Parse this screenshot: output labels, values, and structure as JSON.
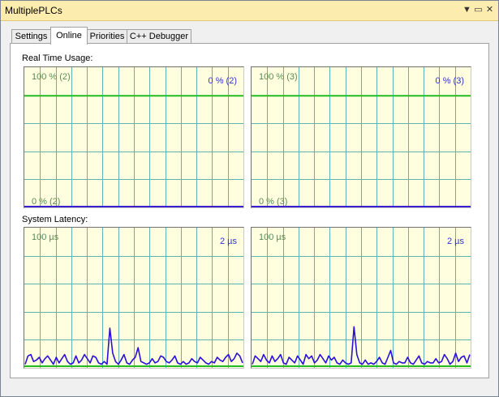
{
  "window": {
    "title": "MultiplePLCs"
  },
  "titlebar_icons": [
    "dropdown-arrow-icon",
    "maximize-icon",
    "close-icon"
  ],
  "titlebar_glyphs": {
    "dropdown": "▼",
    "maximize": "▭",
    "close": "✕"
  },
  "tabs": [
    {
      "label": "Settings",
      "active": false
    },
    {
      "label": "Online",
      "active": true
    },
    {
      "label": "Priorities",
      "active": false
    },
    {
      "label": "C++ Debugger",
      "active": false
    }
  ],
  "real_time_usage": {
    "label": "Real Time Usage:",
    "charts": [
      {
        "max_label": "100 % (2)",
        "current_label": "0 % (2)",
        "min_label": "0 % (2)",
        "limit_percent": 80,
        "usage_percent": 0
      },
      {
        "max_label": "100 % (3)",
        "current_label": "0 % (3)",
        "min_label": "0 % (3)",
        "limit_percent": 80,
        "usage_percent": 0
      }
    ]
  },
  "system_latency": {
    "label": "System Latency:",
    "charts": [
      {
        "max_label": "100 µs",
        "current_label": "2 µs"
      },
      {
        "max_label": "100 µs",
        "current_label": "2 µs"
      }
    ]
  },
  "colors": {
    "chart_background": "#ffffe0",
    "grid": "#5fb3b3",
    "limit_line": "#22bb22",
    "usage_line": "#3a1fd0",
    "latency_trace": "#2a10d8"
  },
  "chart_data": [
    {
      "type": "line",
      "title": "Real Time Usage (2)",
      "ylim": [
        0,
        100
      ],
      "ylabel": "%",
      "series": [
        {
          "name": "",
          "values": [
            0,
            0,
            0,
            0,
            0,
            0,
            0,
            0,
            0,
            0,
            0,
            0,
            0,
            0,
            0,
            0,
            0,
            0,
            0,
            0
          ]
        }
      ]
    },
    {
      "type": "line",
      "title": "Real Time Usage (3)",
      "ylim": [
        0,
        100
      ],
      "ylabel": "%",
      "series": [
        {
          "name": "",
          "values": [
            0,
            0,
            0,
            0,
            0,
            0,
            0,
            0,
            0,
            0,
            0,
            0,
            0,
            0,
            0,
            0,
            0,
            0,
            0,
            0
          ]
        }
      ]
    },
    {
      "type": "line",
      "title": "System Latency",
      "ylim": [
        0,
        100
      ],
      "ylabel": "µs",
      "series": [
        {
          "name": "",
          "values": [
            2,
            8,
            9,
            4,
            5,
            7,
            3,
            6,
            8,
            5,
            2,
            7,
            3,
            6,
            9,
            4,
            2,
            3,
            8,
            3,
            5,
            9,
            6,
            3,
            8,
            7,
            3,
            2,
            4,
            2,
            28,
            10,
            4,
            2,
            5,
            9,
            3,
            2,
            5,
            7,
            14,
            4,
            3,
            2,
            3,
            6,
            3,
            4,
            8,
            7,
            4,
            3,
            5,
            8,
            3,
            2,
            4,
            2,
            3,
            6,
            4,
            3,
            7,
            5,
            3,
            2,
            4,
            3,
            7,
            5,
            4,
            7,
            9,
            4,
            6,
            10,
            8,
            3
          ]
        }
      ]
    },
    {
      "type": "line",
      "title": "System Latency",
      "ylim": [
        0,
        100
      ],
      "ylabel": "µs",
      "series": [
        {
          "name": "",
          "values": [
            2,
            8,
            6,
            4,
            9,
            5,
            3,
            8,
            4,
            6,
            9,
            3,
            2,
            7,
            5,
            3,
            8,
            5,
            2,
            9,
            6,
            8,
            3,
            5,
            9,
            6,
            3,
            8,
            5,
            7,
            3,
            2,
            5,
            3,
            2,
            3,
            29,
            9,
            3,
            2,
            5,
            2,
            3,
            2,
            4,
            7,
            3,
            2,
            7,
            12,
            3,
            2,
            4,
            3,
            3,
            7,
            3,
            2,
            5,
            8,
            3,
            2,
            4,
            3,
            3,
            6,
            3,
            4,
            9,
            6,
            2,
            4,
            10,
            4,
            7,
            8,
            3,
            9
          ]
        }
      ]
    }
  ]
}
